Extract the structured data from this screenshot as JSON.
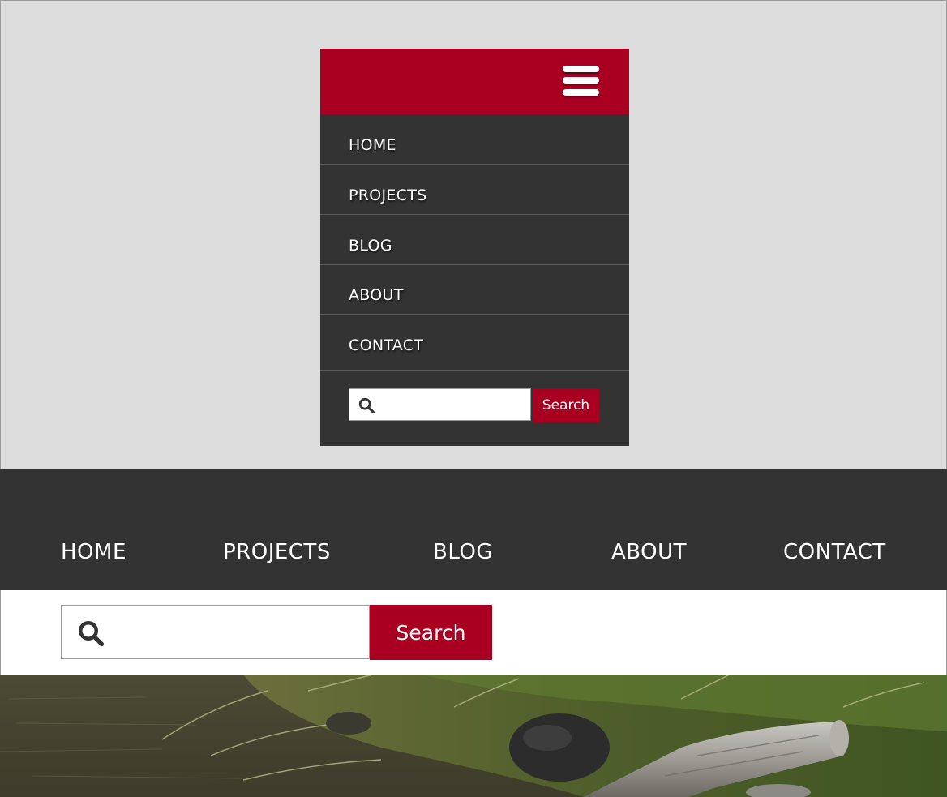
{
  "colors": {
    "brand_red": "#a90022",
    "nav_dark": "#333333",
    "page_gray": "#dcdcdc"
  },
  "mobile_menu": {
    "menu_icon": "hamburger-icon",
    "items": [
      {
        "label": "HOME"
      },
      {
        "label": "PROJECTS"
      },
      {
        "label": "BLOG"
      },
      {
        "label": "ABOUT"
      },
      {
        "label": "CONTACT"
      }
    ],
    "search": {
      "icon": "search-icon",
      "value": "",
      "button_label": "Search"
    }
  },
  "desktop_nav": {
    "items": [
      {
        "label": "HOME"
      },
      {
        "label": "PROJECTS"
      },
      {
        "label": "BLOG"
      },
      {
        "label": "ABOUT"
      },
      {
        "label": "CONTACT"
      }
    ]
  },
  "desktop_search": {
    "icon": "search-icon",
    "value": "",
    "button_label": "Search"
  }
}
